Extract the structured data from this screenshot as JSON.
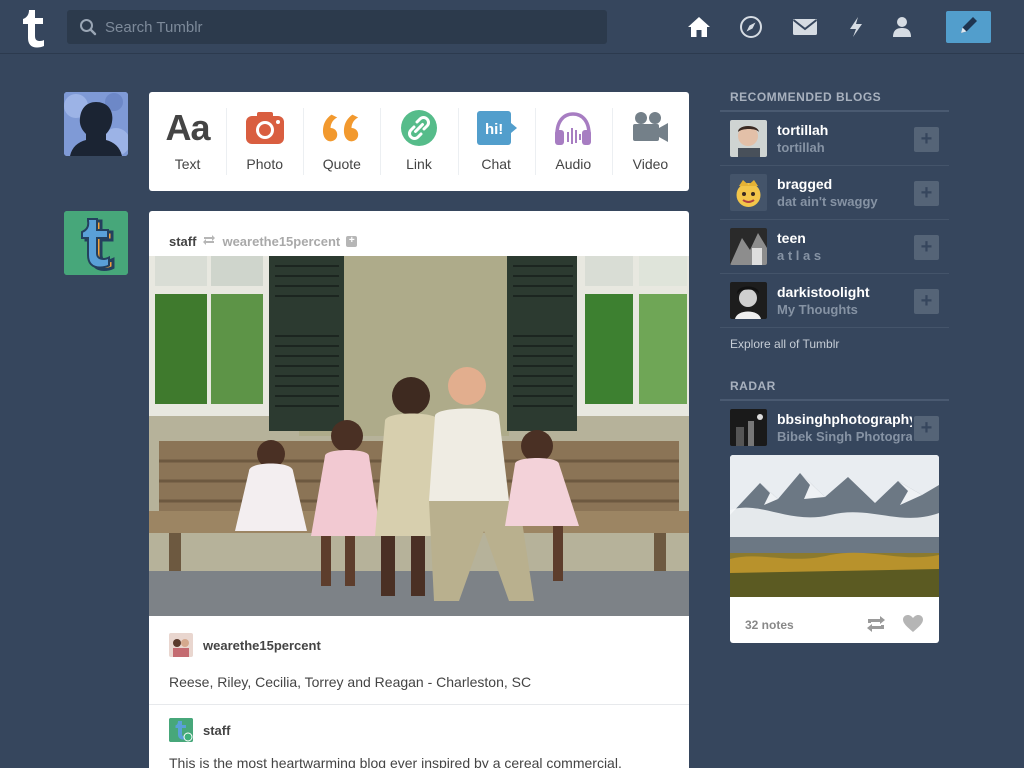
{
  "header": {
    "search_placeholder": "Search Tumblr",
    "nav": [
      "home-icon",
      "explore-compass-icon",
      "inbox-envelope-icon",
      "activity-lightning-icon",
      "account-person-icon"
    ],
    "compose_icon": "pencil-icon"
  },
  "post_types": [
    {
      "label": "Text",
      "icon": "text-aa-icon",
      "glyph": "Aa",
      "color": "#444444"
    },
    {
      "label": "Photo",
      "icon": "camera-icon",
      "color": "#d95e40"
    },
    {
      "label": "Quote",
      "icon": "quote-icon",
      "color": "#f2992e"
    },
    {
      "label": "Link",
      "icon": "link-icon",
      "color": "#56bc8a"
    },
    {
      "label": "Chat",
      "icon": "chat-bubble-icon",
      "glyph": "hi!",
      "color": "#529ecc"
    },
    {
      "label": "Audio",
      "icon": "headphones-icon",
      "color": "#a77dc2"
    },
    {
      "label": "Video",
      "icon": "video-camera-icon",
      "color": "#748089"
    }
  ],
  "post": {
    "author": "staff",
    "reblogged_from": "wearethe15percent",
    "source_blog": "wearethe15percent",
    "caption": "Reese, Riley, Cecilia, Torrey and Reagan - Charleston, SC",
    "reblogger": "staff",
    "reblog_text": "This is the most heartwarming blog ever inspired by a cereal commercial."
  },
  "recommended": {
    "title": "RECOMMENDED BLOGS",
    "blogs": [
      {
        "name": "tortillah",
        "subtitle": "tortillah"
      },
      {
        "name": "bragged",
        "subtitle": "dat ain't swaggy"
      },
      {
        "name": "teen",
        "subtitle": "a t l a s"
      },
      {
        "name": "darkistoolight",
        "subtitle": "My Thoughts"
      }
    ],
    "explore_link": "Explore all of Tumblr"
  },
  "radar": {
    "title": "RADAR",
    "blog_name": "bbsinghphotography",
    "blog_subtitle": "Bibek Singh Photography",
    "notes": "32 notes"
  },
  "colors": {
    "background": "#36465d",
    "accent": "#529ecc"
  }
}
